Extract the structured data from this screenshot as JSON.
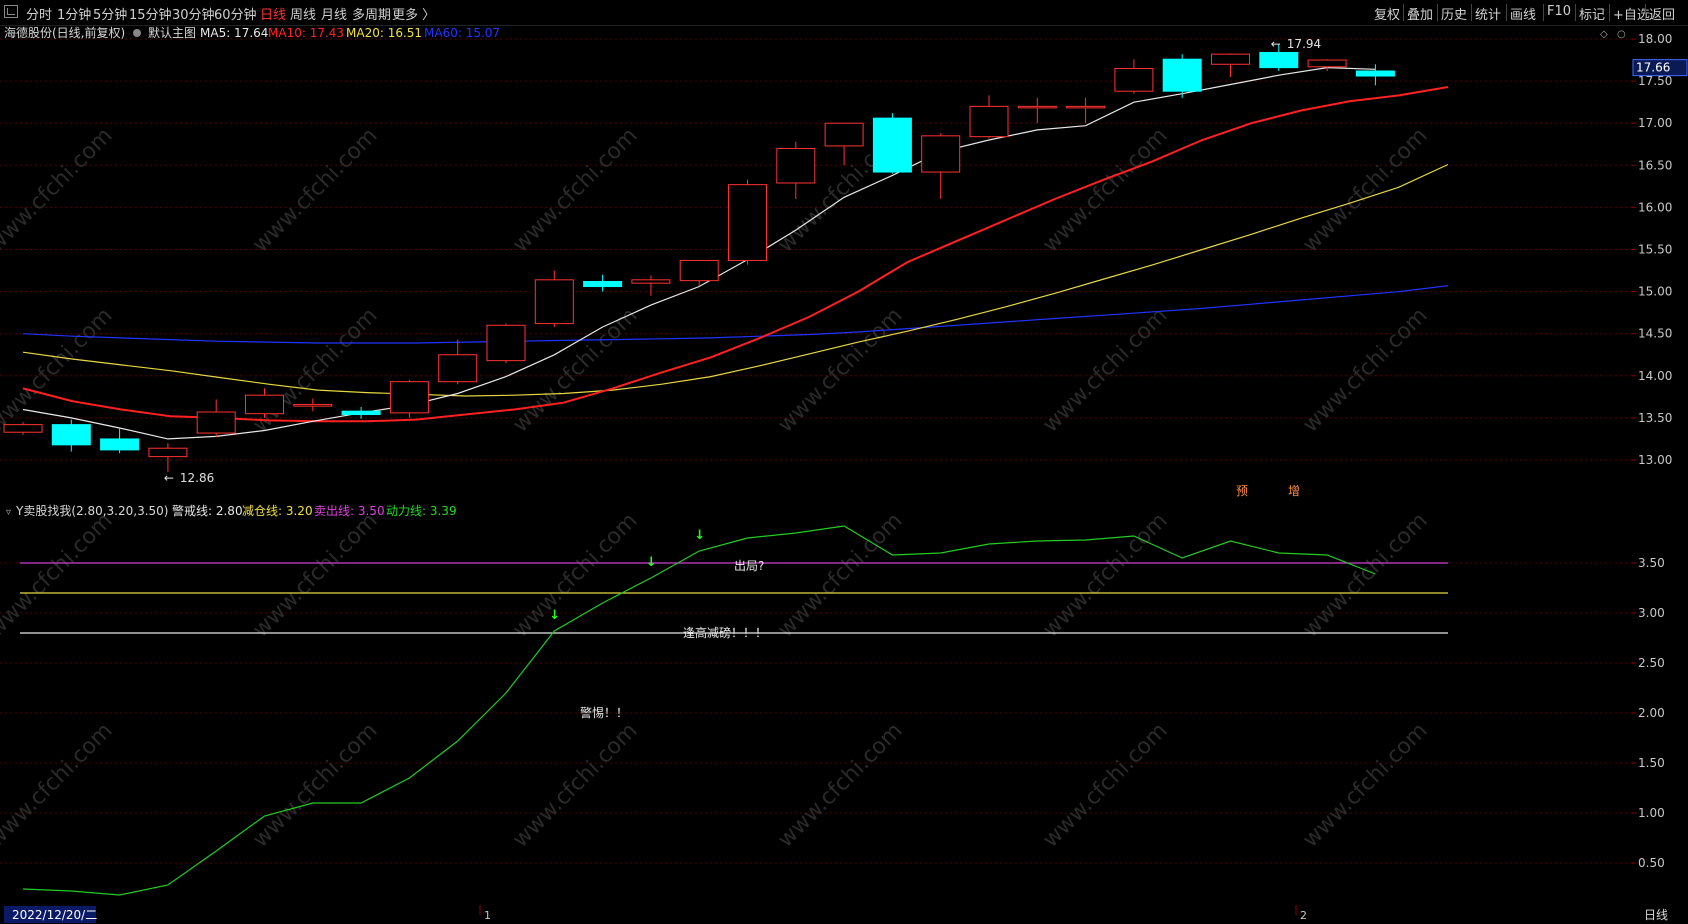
{
  "toolbar": {
    "periods": [
      "分时",
      "1分钟",
      "5分钟",
      "15分钟",
      "30分钟",
      "60分钟",
      "日线",
      "周线",
      "月线",
      "多周期"
    ],
    "active_period": "日线",
    "more": "更多 〉",
    "right_buttons": [
      "复权",
      "叠加",
      "历史",
      "统计",
      "画线",
      "F10",
      "标记",
      "+自选",
      "返回"
    ]
  },
  "main_chart": {
    "stock_title": "海德股份(日线,前复权)",
    "template_name": "默认主图",
    "ma_labels": [
      {
        "text": "MA5: 17.64",
        "color": "#e8e8e8"
      },
      {
        "text": "MA10: 17.43",
        "color": "#ff2222"
      },
      {
        "text": "MA20: 16.51",
        "color": "#f0e040"
      },
      {
        "text": "MA60: 15.07",
        "color": "#2233ff"
      }
    ],
    "y_ticks": [
      "18.00",
      "17.50",
      "17.00",
      "16.50",
      "16.00",
      "15.50",
      "15.00",
      "14.50",
      "14.00",
      "13.50",
      "13.00"
    ],
    "current_price": "17.66",
    "high_marker": "17.94",
    "low_marker": "12.86",
    "signal_labels": [
      "预",
      "增"
    ],
    "candles": [
      {
        "o": 13.33,
        "c": 13.42,
        "h": 13.45,
        "l": 13.3
      },
      {
        "o": 13.42,
        "c": 13.18,
        "h": 13.48,
        "l": 13.1
      },
      {
        "o": 13.25,
        "c": 13.12,
        "h": 13.38,
        "l": 13.08
      },
      {
        "o": 13.04,
        "c": 13.14,
        "h": 13.2,
        "l": 12.86
      },
      {
        "o": 13.32,
        "c": 13.57,
        "h": 13.72,
        "l": 13.27
      },
      {
        "o": 13.55,
        "c": 13.77,
        "h": 13.85,
        "l": 13.5
      },
      {
        "o": 13.64,
        "c": 13.66,
        "h": 13.73,
        "l": 13.58
      },
      {
        "o": 13.58,
        "c": 13.54,
        "h": 13.63,
        "l": 13.49
      },
      {
        "o": 13.56,
        "c": 13.93,
        "h": 13.95,
        "l": 13.5
      },
      {
        "o": 13.93,
        "c": 14.25,
        "h": 14.43,
        "l": 13.9
      },
      {
        "o": 14.18,
        "c": 14.6,
        "h": 14.62,
        "l": 14.15
      },
      {
        "o": 14.62,
        "c": 15.14,
        "h": 15.25,
        "l": 14.58
      },
      {
        "o": 15.12,
        "c": 15.06,
        "h": 15.2,
        "l": 15.0
      },
      {
        "o": 15.1,
        "c": 15.14,
        "h": 15.19,
        "l": 14.95
      },
      {
        "o": 15.13,
        "c": 15.37,
        "h": 15.37,
        "l": 15.07
      },
      {
        "o": 15.37,
        "c": 16.27,
        "h": 16.33,
        "l": 15.32
      },
      {
        "o": 16.29,
        "c": 16.7,
        "h": 16.78,
        "l": 16.1
      },
      {
        "o": 16.73,
        "c": 17.0,
        "h": 17.0,
        "l": 16.5
      },
      {
        "o": 17.06,
        "c": 16.42,
        "h": 17.12,
        "l": 16.4
      },
      {
        "o": 16.42,
        "c": 16.85,
        "h": 16.88,
        "l": 16.1
      },
      {
        "o": 16.84,
        "c": 17.2,
        "h": 17.33,
        "l": 16.82
      },
      {
        "o": 17.2,
        "c": 17.2,
        "h": 17.3,
        "l": 17.0
      },
      {
        "o": 17.2,
        "c": 17.2,
        "h": 17.3,
        "l": 17.0
      },
      {
        "o": 17.38,
        "c": 17.65,
        "h": 17.76,
        "l": 17.35
      },
      {
        "o": 17.76,
        "c": 17.38,
        "h": 17.82,
        "l": 17.3
      },
      {
        "o": 17.7,
        "c": 17.82,
        "h": 17.83,
        "l": 17.55
      },
      {
        "o": 17.84,
        "c": 17.66,
        "h": 17.94,
        "l": 17.62
      },
      {
        "o": 17.67,
        "c": 17.75,
        "h": 17.76,
        "l": 17.62
      },
      {
        "o": 17.62,
        "c": 17.56,
        "h": 17.7,
        "l": 17.45
      }
    ],
    "ma5": [
      13.6,
      13.5,
      13.38,
      13.25,
      13.28,
      13.35,
      13.46,
      13.56,
      13.65,
      13.79,
      13.99,
      14.25,
      14.58,
      14.84,
      15.06,
      15.38,
      15.73,
      16.12,
      16.38,
      16.66,
      16.8,
      16.92,
      16.97,
      17.25,
      17.35,
      17.46,
      17.57,
      17.66,
      17.64
    ],
    "ma10": [
      13.85,
      13.7,
      13.6,
      13.52,
      13.5,
      13.47,
      13.46,
      13.46,
      13.48,
      13.54,
      13.6,
      13.68,
      13.85,
      14.04,
      14.22,
      14.45,
      14.7,
      15.0,
      15.35,
      15.6,
      15.85,
      16.1,
      16.33,
      16.55,
      16.8,
      17.0,
      17.15,
      17.26,
      17.33,
      17.43
    ],
    "ma20": [
      14.28,
      14.2,
      14.13,
      14.06,
      13.98,
      13.9,
      13.83,
      13.8,
      13.78,
      13.76,
      13.77,
      13.79,
      13.83,
      13.9,
      13.99,
      14.12,
      14.26,
      14.4,
      14.53,
      14.67,
      14.82,
      14.98,
      15.15,
      15.32,
      15.5,
      15.68,
      15.87,
      16.05,
      16.24,
      16.51
    ],
    "ma60": [
      14.5,
      14.47,
      14.45,
      14.43,
      14.41,
      14.4,
      14.39,
      14.39,
      14.39,
      14.4,
      14.41,
      14.42,
      14.43,
      14.44,
      14.45,
      14.47,
      14.49,
      14.52,
      14.56,
      14.6,
      14.64,
      14.68,
      14.72,
      14.76,
      14.8,
      14.85,
      14.9,
      14.95,
      15.0,
      15.07
    ]
  },
  "indicator": {
    "name": "Y卖股找我(2.80,3.20,3.50)",
    "labels": [
      {
        "text": "警戒线: 2.80",
        "color": "#e8e8e8"
      },
      {
        "text": "减仓线: 3.20",
        "color": "#f0e040"
      },
      {
        "text": "卖出线: 3.50",
        "color": "#e040e0"
      },
      {
        "text": "动力线: 3.39",
        "color": "#22dd22"
      }
    ],
    "y_ticks": [
      "3.50",
      "3.00",
      "2.50",
      "2.00",
      "1.50",
      "1.00",
      "0.50"
    ],
    "warn_line": 2.8,
    "reduce_line": 3.2,
    "sell_line": 3.5,
    "power": [
      0.24,
      0.22,
      0.18,
      0.28,
      0.62,
      0.97,
      1.1,
      1.1,
      1.35,
      1.72,
      2.2,
      2.82,
      3.1,
      3.35,
      3.62,
      3.75,
      3.8,
      3.87,
      3.58,
      3.6,
      3.69,
      3.72,
      3.73,
      3.77,
      3.55,
      3.72,
      3.6,
      3.58,
      3.39
    ],
    "annotations": {
      "exit": "出局?",
      "reduce": "逢高减磅！！！",
      "alert": "警惕！！"
    }
  },
  "footer": {
    "date": "2022/12/20/二",
    "marker_1": "1",
    "marker_2": "2",
    "period_label": "日线"
  },
  "watermark": "www.cfchi.com",
  "colors": {
    "up": "#ff3232",
    "down": "#00ffff",
    "bg": "#000000",
    "grid": "#5a0000",
    "axis_text": "#c8c8c8"
  }
}
